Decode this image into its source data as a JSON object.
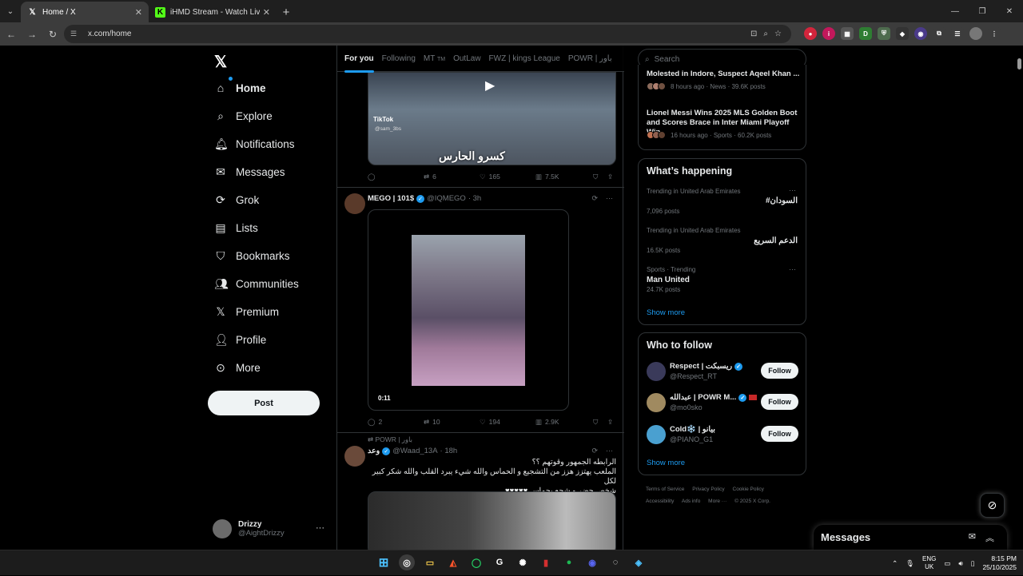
{
  "browser": {
    "tabs": [
      {
        "title": "Home / X",
        "active": true,
        "favicon": "x-logo"
      },
      {
        "title": "iHMD Stream - Watch Live on K",
        "active": false,
        "favicon": "kick-logo"
      }
    ],
    "url": "x.com/home"
  },
  "left_nav": {
    "items": [
      {
        "label": "Home",
        "icon": "home-icon"
      },
      {
        "label": "Explore",
        "icon": "search-icon"
      },
      {
        "label": "Notifications",
        "icon": "bell-icon"
      },
      {
        "label": "Messages",
        "icon": "mail-icon"
      },
      {
        "label": "Grok",
        "icon": "grok-icon"
      },
      {
        "label": "Lists",
        "icon": "list-icon"
      },
      {
        "label": "Bookmarks",
        "icon": "bookmark-icon"
      },
      {
        "label": "Communities",
        "icon": "people-icon"
      },
      {
        "label": "Premium",
        "icon": "x-icon"
      },
      {
        "label": "Profile",
        "icon": "person-icon"
      },
      {
        "label": "More",
        "icon": "more-circle-icon"
      }
    ],
    "post_label": "Post",
    "account": {
      "name": "Drizzy",
      "handle": "@AightDrizzy"
    }
  },
  "feed": {
    "tabs": [
      "For you",
      "Following",
      "MT",
      "OutLaw",
      "FWZ | kings League",
      "POWR | باور"
    ],
    "tab_badge": "TM",
    "tweet1": {
      "tiktok_label": "TikTok",
      "tiktok_handle": "@sam_3bs",
      "caption": "كسرو الحارس",
      "replies": "",
      "reposts": "6",
      "likes": "165",
      "views": "7.5K"
    },
    "tweet2": {
      "name": "MEGO | 101$",
      "handle": "@IQMEGO",
      "time": "· 3h",
      "duration": "0:11",
      "replies": "2",
      "reposts": "10",
      "likes": "194",
      "views": "2.9K"
    },
    "tweet3": {
      "reposted_by": "POWR | باور",
      "name": "وعد",
      "handle": "@Waad_13A",
      "time": "· 18h",
      "text_lines": [
        "الرابطه الجمهور وقوتهم ؟؟",
        "الملعب يهتزز هزز من التشجيع و الحماس والله شيء يبرد القلب والله شكر كبير لكل",
        "شخص حضر و شجع بحماس ♥♥♥♥♥"
      ]
    }
  },
  "right_col": {
    "search_placeholder": "Search",
    "news": [
      {
        "title": "Molested in Indore, Suspect Aqeel Khan ...",
        "meta": "8 hours ago · News · 39.6K posts"
      },
      {
        "title": "Lionel Messi Wins 2025 MLS Golden Boot and Scores Brace in Inter Miami Playoff Win",
        "meta": "16 hours ago · Sports · 60.2K posts"
      }
    ],
    "happening_title": "What’s happening",
    "trends": [
      {
        "context": "Trending in United Arab Emirates",
        "name": "#السودان",
        "count": "7,096 posts"
      },
      {
        "context": "Trending in United Arab Emirates",
        "name": "الدعم السريع",
        "count": "16.5K posts"
      },
      {
        "context": "Sports · Trending",
        "name": "Man United",
        "count": "24.7K posts"
      }
    ],
    "show_more": "Show more",
    "who_to_follow_title": "Who to follow",
    "follow_suggestions": [
      {
        "name": "Respect | ريسبكت",
        "handle": "@Respect_RT"
      },
      {
        "name": "عبدالله | POWR M...",
        "handle": "@mo0sko"
      },
      {
        "name": "Cold❄️ | بيانو",
        "handle": "@PIANO_G1"
      }
    ],
    "follow_label": "Follow",
    "footer": [
      "Terms of Service",
      "Privacy Policy",
      "Cookie Policy",
      "Accessibility",
      "Ads info",
      "More ···",
      "© 2025 X Corp."
    ]
  },
  "messages_drawer": {
    "title": "Messages"
  },
  "taskbar": {
    "lang_top": "ENG",
    "lang_bottom": "UK",
    "time": "8:15 PM",
    "date": "25/10/2025"
  },
  "colors": {
    "accent": "#1d9bf0",
    "background": "#000000",
    "border": "#2f3336",
    "muted": "#71767b"
  }
}
